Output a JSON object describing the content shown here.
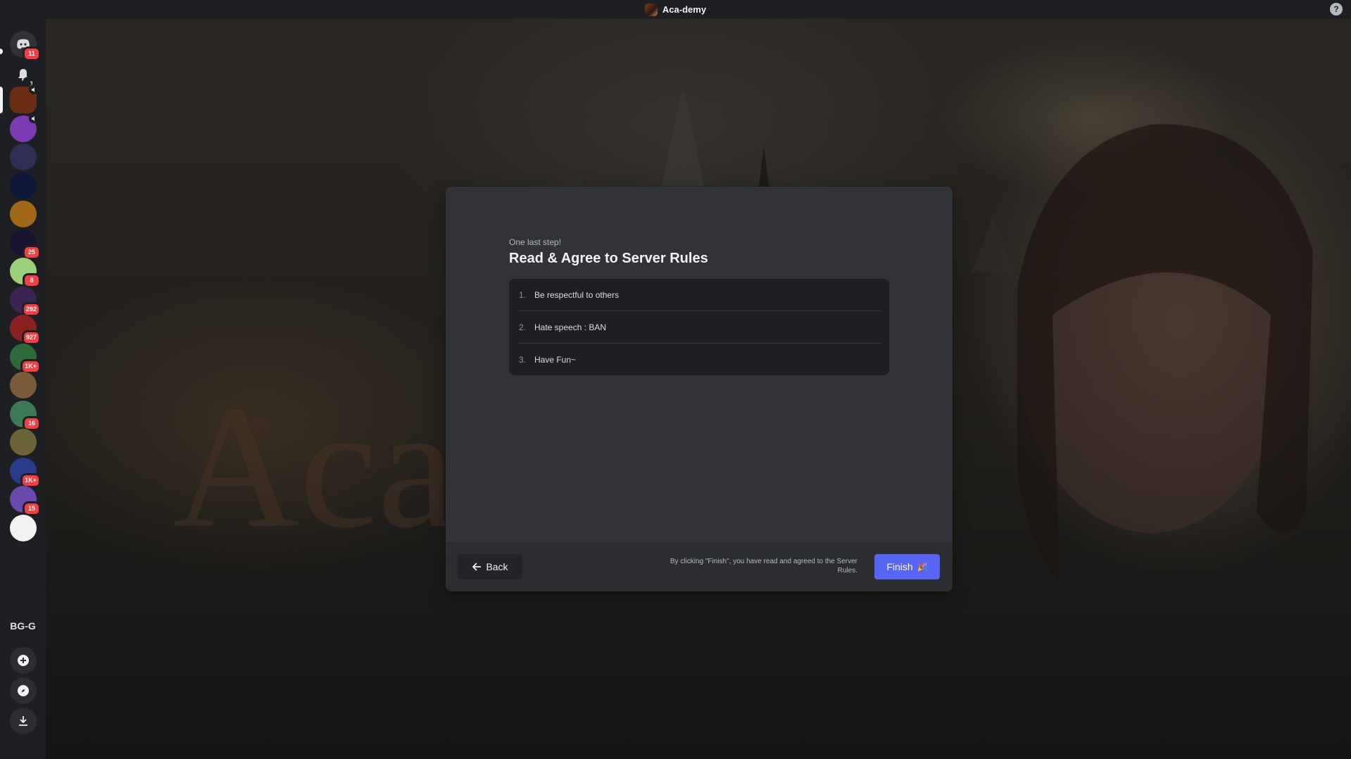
{
  "window": {
    "title": "Aca-demy",
    "help_label": "?"
  },
  "rail": {
    "home_badge": "11",
    "inbox_badge": "1",
    "guilds": [
      {
        "name": "server-1",
        "badge": "",
        "color": "#6b2c14"
      },
      {
        "name": "server-2",
        "badge": "",
        "color": "#7a3bb3"
      },
      {
        "name": "server-3",
        "badge": "",
        "color": "#2f2f56"
      },
      {
        "name": "server-4",
        "badge": "",
        "color": "#0e1836"
      },
      {
        "name": "server-5",
        "badge": "",
        "color": "#a2681a"
      },
      {
        "name": "server-6",
        "badge": "25",
        "color": "#1a1330"
      },
      {
        "name": "server-7",
        "badge": "8",
        "color": "#9bd07a"
      },
      {
        "name": "server-8",
        "badge": "292",
        "color": "#3a2552"
      },
      {
        "name": "server-9",
        "badge": "927",
        "color": "#8a2020"
      },
      {
        "name": "server-10",
        "badge": "1K+",
        "color": "#2c6a3a"
      },
      {
        "name": "server-11",
        "badge": "",
        "color": "#7a5b3a"
      },
      {
        "name": "server-12",
        "badge": "16",
        "color": "#3b7a55"
      },
      {
        "name": "server-13",
        "badge": "",
        "color": "#6b6438"
      },
      {
        "name": "server-14",
        "badge": "1K+",
        "color": "#2a3b8a"
      },
      {
        "name": "server-15",
        "badge": "15",
        "color": "#6b4ab0"
      },
      {
        "name": "server-16",
        "badge": "",
        "color": "#f2f2f2"
      }
    ],
    "text_guild": "BG-G"
  },
  "background": {
    "watermark_text": "Aca-"
  },
  "modal": {
    "eyebrow": "One last step!",
    "title": "Read & Agree to Server Rules",
    "rules": [
      {
        "num": "1.",
        "text": "Be respectful to others"
      },
      {
        "num": "2.",
        "text": "Hate speech : BAN"
      },
      {
        "num": "3.",
        "text": "Have Fun~"
      }
    ],
    "footer": {
      "back_label": "Back",
      "disclaimer": "By clicking \"Finish\", you have read and agreed to the Server Rules.",
      "finish_label": "Finish",
      "finish_emoji": "🎉",
      "accent_color": "#5865f2"
    }
  }
}
